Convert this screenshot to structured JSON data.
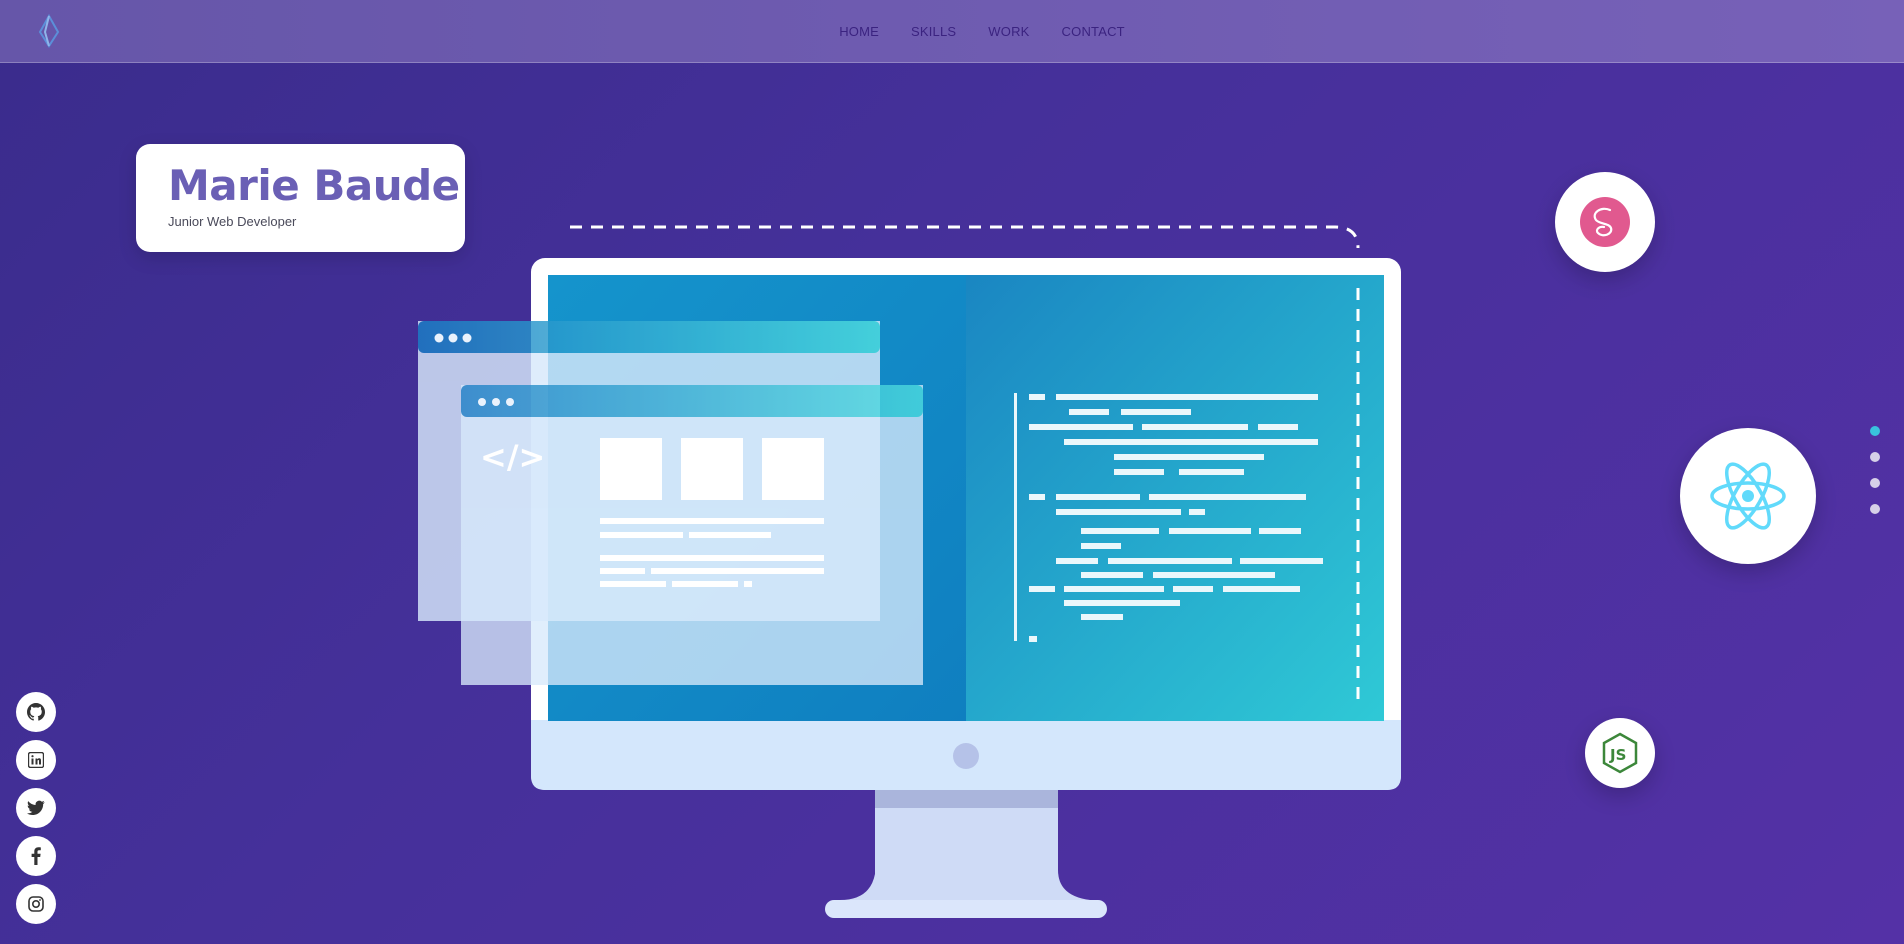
{
  "nav": {
    "links": [
      {
        "label": "HOME"
      },
      {
        "label": "SKILLS"
      },
      {
        "label": "WORK"
      },
      {
        "label": "CONTACT"
      }
    ]
  },
  "hero": {
    "name": "Marie Baude",
    "role": "Junior Web Developer",
    "illustration_icon": "</>"
  },
  "tech_badges": [
    {
      "icon": "sass-logo-icon"
    },
    {
      "icon": "react-logo-icon"
    },
    {
      "icon": "nodejs-logo-icon"
    }
  ],
  "pagination": {
    "count": 4,
    "active_index": 0
  },
  "socials": [
    {
      "icon": "github-icon"
    },
    {
      "icon": "linkedin-icon"
    },
    {
      "icon": "twitter-icon"
    },
    {
      "icon": "facebook-icon"
    },
    {
      "icon": "instagram-icon"
    }
  ],
  "colors": {
    "background": "#45309a",
    "navbar": "#7761b8",
    "accent": "#6a5fb5",
    "active_dot": "#39c2dd",
    "sass_pink": "#e1598f",
    "react_cyan": "#61dafb",
    "node_green": "#3c873a"
  }
}
